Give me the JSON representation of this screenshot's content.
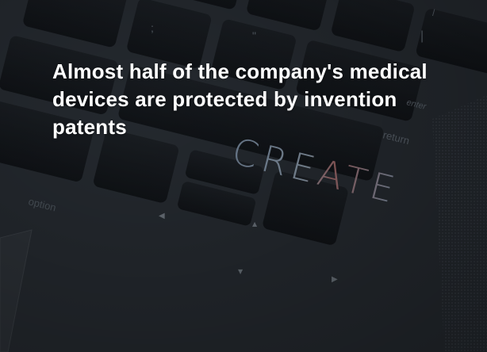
{
  "card": {
    "headline": "Almost half of the company's medical devices are protected by invention patents"
  },
  "background": {
    "keys": {
      "option": "option",
      "return": "return",
      "enter": "enter",
      "create": "CREATE",
      "left_arrow": "◀",
      "up_arrow": "▲",
      "down_arrow": "▼",
      "right_arrow": "▶",
      "quote": "\"",
      "semicolon": ";",
      "slash": "/",
      "bar": "|"
    }
  },
  "colors": {
    "background": "#23282e",
    "key": "#14171b",
    "key_label": "#4a525b",
    "headline": "#ffffff",
    "create_warm": "#b56a6a",
    "create_cool": "#8aa0b8"
  }
}
